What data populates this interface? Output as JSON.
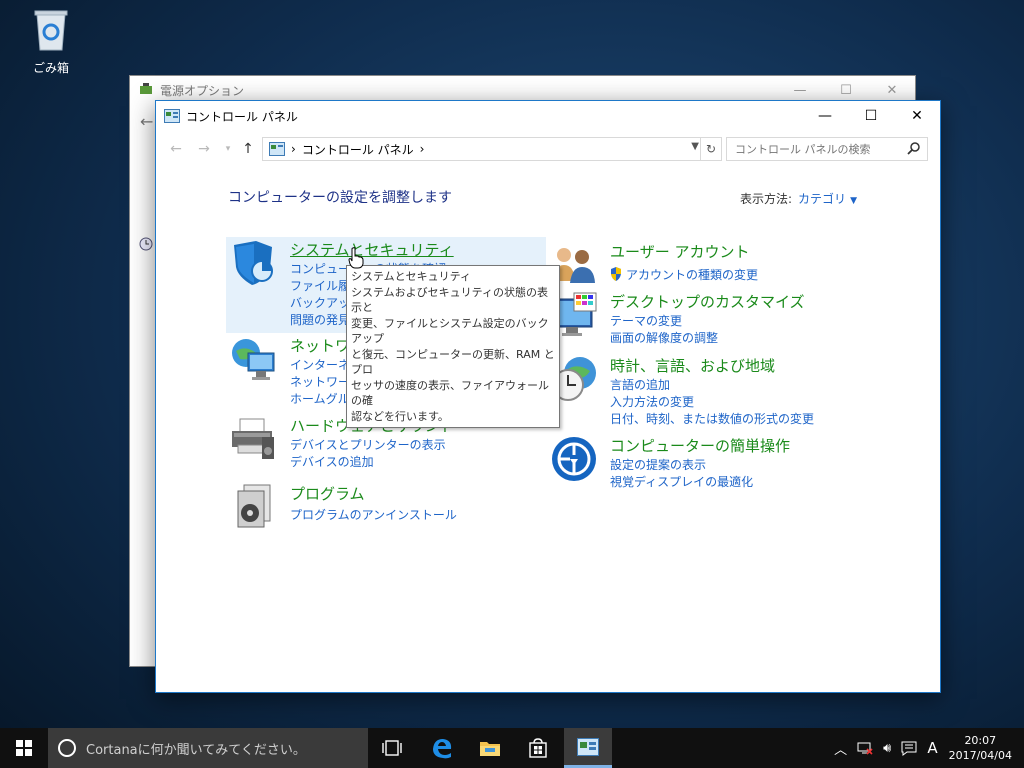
{
  "desktop": {
    "recycle_bin_label": "ごみ箱"
  },
  "background_window": {
    "title": "電源オプション"
  },
  "window": {
    "title": "コントロール パネル",
    "controls": {
      "minimize": "—",
      "maximize": "☐",
      "close": "✕"
    }
  },
  "address_bar": {
    "path_item": "コントロール パネル",
    "separator": "›"
  },
  "search": {
    "placeholder": "コントロール パネルの検索"
  },
  "main": {
    "heading": "コンピューターの設定を調整します",
    "view_by_label": "表示方法:",
    "view_by_value": "カテゴリ"
  },
  "categories": {
    "system": {
      "title": "システムとセキュリティ",
      "links": [
        "コンピューターの状態を確認",
        "ファイル履歴で",
        "バックアップと",
        "問題の発見"
      ]
    },
    "network": {
      "title": "ネットワーク",
      "links": [
        "インターネットへの接続",
        "ネットワークの状態とタスクの表示",
        "ホームグループと共有に関するオプションの選択"
      ]
    },
    "hardware": {
      "title": "ハードウェアとサウンド",
      "links": [
        "デバイスとプリンターの表示",
        "デバイスの追加"
      ]
    },
    "programs": {
      "title": "プログラム",
      "links": [
        "プログラムのアンインストール"
      ]
    },
    "user": {
      "title": "ユーザー アカウント",
      "links": [
        "アカウントの種類の変更"
      ]
    },
    "desktop": {
      "title": "デスクトップのカスタマイズ",
      "links": [
        "テーマの変更",
        "画面の解像度の調整"
      ]
    },
    "clock": {
      "title": "時計、言語、および地域",
      "links": [
        "言語の追加",
        "入力方法の変更",
        "日付、時刻、または数値の形式の変更"
      ]
    },
    "ease": {
      "title": "コンピューターの簡単操作",
      "links": [
        "設定の提案の表示",
        "視覚ディスプレイの最適化"
      ]
    }
  },
  "tooltip": {
    "title": "システムとセキュリティ",
    "lines": [
      "システムおよびセキュリティの状態の表示と",
      "変更、ファイルとシステム設定のバックアップ",
      "と復元、コンピューターの更新、RAM とプロ",
      "セッサの速度の表示、ファイアウォールの確",
      "認などを行います。"
    ]
  },
  "taskbar": {
    "cortana_text": "Cortanaに何か聞いてみてください。",
    "ime": "A",
    "time": "20:07",
    "date": "2017/04/04"
  },
  "colors": {
    "link": "#1e64c8",
    "category": "#1a8a1a",
    "heading": "#1e3287",
    "accent": "#1e78c8"
  }
}
